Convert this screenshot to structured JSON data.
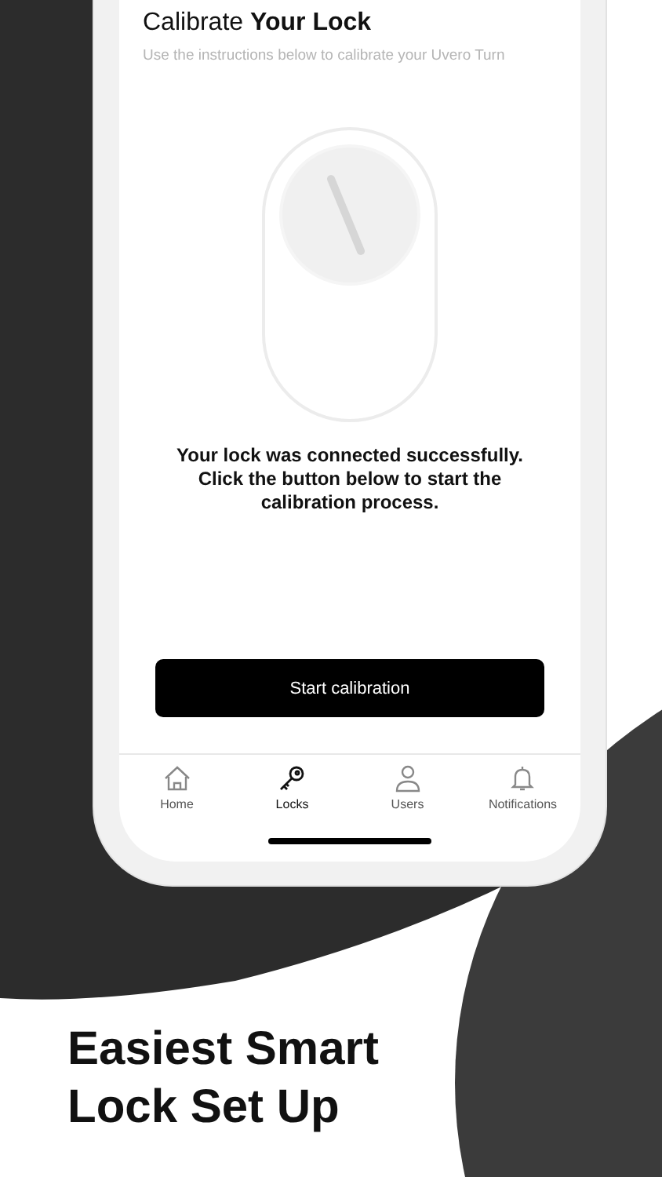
{
  "screen": {
    "title": "Calibrate **Your Lock**",
    "subtitle": "Use the instructions below to calibrate your Uvero Turn",
    "message": "Your lock was connected successfully. Click the button below to start the calibration process.",
    "button": "Start calibration"
  },
  "tab_bar": [
    {
      "label": "Home",
      "kind": "home",
      "selected": false
    },
    {
      "label": "Locks",
      "kind": "key",
      "selected": true
    },
    {
      "label": "Users",
      "kind": "user",
      "selected": false
    },
    {
      "label": "Notifications",
      "kind": "bell",
      "selected": false
    }
  ],
  "headline": "Easiest Smart Lock Set Up"
}
